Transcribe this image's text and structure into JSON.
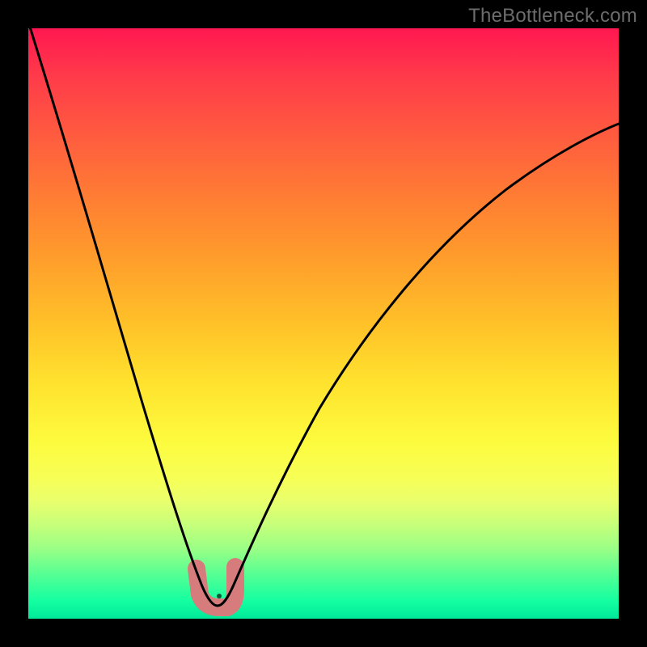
{
  "watermark": "TheBottleneck.com",
  "colors": {
    "frame": "#000000",
    "watermark_text": "#6c6c6c",
    "curve": "#000000",
    "marker": "#d67c7c",
    "gradient_top": "#ff1750",
    "gradient_bottom": "#00e99a"
  },
  "chart_data": {
    "type": "line",
    "title": "",
    "xlabel": "",
    "ylabel": "",
    "xlim": [
      0,
      100
    ],
    "ylim": [
      0,
      100
    ],
    "grid": false,
    "legend": false,
    "series": [
      {
        "name": "bottleneck-curve",
        "x": [
          0,
          5,
          10,
          15,
          20,
          23,
          26,
          28,
          30,
          31.5,
          33,
          35,
          38,
          42,
          48,
          55,
          63,
          72,
          82,
          92,
          100
        ],
        "y": [
          100,
          81,
          62,
          44,
          27,
          17,
          9,
          5,
          2,
          1,
          2,
          5,
          10,
          17,
          27,
          38,
          49,
          59,
          68,
          76,
          81
        ]
      }
    ],
    "annotations": [
      {
        "name": "optimal-marker",
        "shape": "u-blob",
        "approx_center_x": 31,
        "approx_center_y": 3,
        "color": "#d67c7c"
      }
    ]
  }
}
